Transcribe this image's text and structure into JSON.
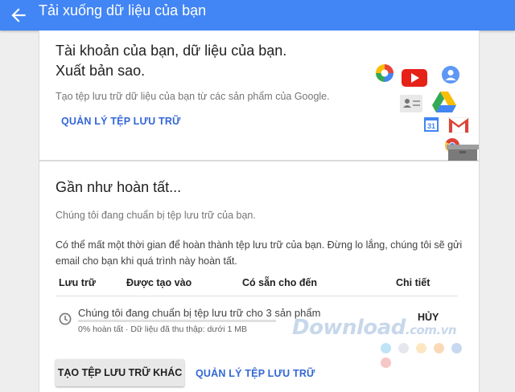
{
  "header": {
    "title": "Tải xuống dữ liệu của bạn",
    "back_icon": "arrow-back-icon"
  },
  "intro": {
    "line1": "Tài khoản của bạn, dữ liệu của bạn.",
    "line2": "Xuất bản sao.",
    "description": "Tạo tệp lưu trữ dữ liệu của bạn từ các sản phẩm của Google.",
    "manage_link": "QUẢN LÝ TỆP LƯU TRỮ",
    "icons": [
      "photos-icon",
      "youtube-icon",
      "profile-icon",
      "contacts-icon",
      "drive-icon",
      "calendar-icon",
      "gmail-icon",
      "chrome-icon",
      "archive-box-icon"
    ]
  },
  "status": {
    "title": "Gần như hoàn tất...",
    "subtitle": "Chúng tôi đang chuẩn bị tệp lưu trữ của bạn.",
    "info": "Có thể mất một thời gian để hoàn thành tệp lưu trữ của bạn. Đừng lo lắng, chúng tôi sẽ gửi email cho bạn khi quá trình này hoàn tất."
  },
  "table": {
    "headers": [
      "Lưu trữ",
      "Được tạo vào",
      "Có sẵn cho đến",
      "Chi tiết"
    ],
    "row": {
      "title": "Chúng tôi đang chuẩn bị tệp lưu trữ cho 3 sản phẩm",
      "status": "0% hoàn tất · Dữ liệu đã thu thập: dưới 1 MB",
      "progress": 0,
      "action": "HỦY"
    }
  },
  "actions": {
    "create_another": "TẠO TỆP LƯU TRỮ KHÁC",
    "manage_link": "QUẢN LÝ TỆP LƯU TRỮ"
  },
  "watermark": {
    "text": "Download",
    "suffix": ".com.vn",
    "dot_colors": [
      "#bfe3f7",
      "#e6e6ee",
      "#fde7c3",
      "#fbd9b7",
      "#c8d8f0",
      "#f6c7c7"
    ]
  },
  "colors": {
    "accent": "#4285f4",
    "link": "#3367d6"
  }
}
